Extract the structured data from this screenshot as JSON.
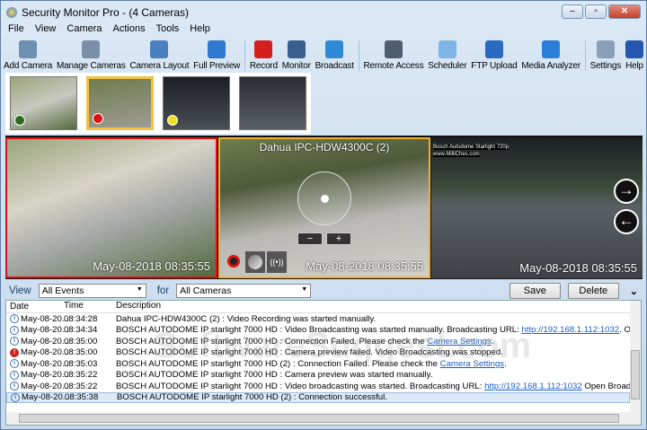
{
  "window": {
    "title": "Security Monitor Pro - (4 Cameras)",
    "min": "–",
    "max": "▫",
    "close": "✕"
  },
  "menu": [
    "File",
    "View",
    "Camera",
    "Actions",
    "Tools",
    "Help"
  ],
  "toolbar": [
    {
      "label": "Add Camera",
      "color": "#6d8fb0"
    },
    {
      "label": "Manage Cameras",
      "color": "#7a90a8"
    },
    {
      "label": "Camera Layout",
      "color": "#4a7fc0"
    },
    {
      "label": "Full Preview",
      "color": "#2f79d0"
    },
    {
      "label": "Record",
      "color": "#d41f1f"
    },
    {
      "label": "Monitor",
      "color": "#3a5f8f"
    },
    {
      "label": "Broadcast",
      "color": "#2e8ad6"
    },
    {
      "label": "Remote Access",
      "color": "#4e5e70"
    },
    {
      "label": "Scheduler",
      "color": "#7fb5e5"
    },
    {
      "label": "FTP Upload",
      "color": "#2a6ac2"
    },
    {
      "label": "Media Analyzer",
      "color": "#2c7fd8"
    },
    {
      "label": "Settings",
      "color": "#8aa0b8"
    },
    {
      "label": "Help",
      "color": "#2458b0"
    }
  ],
  "thumbnails": [
    {
      "dot": "#2d6a1e"
    },
    {
      "dot": "#e01010"
    },
    {
      "dot": "#f0e020"
    },
    {
      "dot": null
    }
  ],
  "cameras": [
    {
      "title": "",
      "timestamp": "May-08-2018 08:35:55"
    },
    {
      "title": "Dahua IPC-HDW4300C (2)",
      "timestamp": "May-08-2018 08:35:55",
      "zoom_out": "−",
      "zoom_in": "+"
    },
    {
      "title": "Bosch Autodome Starlight 720p",
      "subtitle": "www.MilliChes.com",
      "timestamp": "May-08-2018 08:35:55"
    }
  ],
  "events": {
    "view_label": "View",
    "view_value": "All Events",
    "for_label": "for",
    "for_value": "All Cameras",
    "save": "Save",
    "delete": "Delete",
    "columns": [
      "Date",
      "Time",
      "Description"
    ],
    "rows": [
      {
        "type": "info",
        "date": "May-08-20...",
        "time": "08:34:28",
        "desc": "Dahua IPC-HDW4300C (2) : Video Recording was started manually.",
        "link": "",
        "after": ""
      },
      {
        "type": "info",
        "date": "May-08-20...",
        "time": "08:34:34",
        "desc": "BOSCH AUTODOME IP starlight 7000 HD : Video Broadcasting was started manually.  Broadcasting URL: ",
        "link": "http://192.168.1.112:1032",
        "after": ". Open Broadcasting URL in Media"
      },
      {
        "type": "info",
        "date": "May-08-20...",
        "time": "08:35:00",
        "desc": "BOSCH AUTODOME IP starlight 7000 HD : Connection Failed. Please check the ",
        "link": "Camera Settings",
        "after": "."
      },
      {
        "type": "error",
        "date": "May-08-20...",
        "time": "08:35:00",
        "desc": "BOSCH AUTODOME IP starlight 7000 HD : Camera preview failed. Video Broadcasting was stopped.",
        "link": "",
        "after": ""
      },
      {
        "type": "info",
        "date": "May-08-20...",
        "time": "08:35:03",
        "desc": "BOSCH AUTODOME IP starlight 7000 HD (2) :  Connection Failed.  Please check the ",
        "link": "Camera Settings",
        "after": "."
      },
      {
        "type": "info",
        "date": "May-08-20...",
        "time": "08:35:22",
        "desc": "BOSCH AUTODOME IP starlight 7000 HD : Camera preview was started manually.",
        "link": "",
        "after": ""
      },
      {
        "type": "info",
        "date": "May-08-20...",
        "time": "08:35:22",
        "desc": "BOSCH AUTODOME IP starlight 7000 HD : Video broadcasting was started.  Broadcasting URL:  ",
        "link": "http://192.168.1.112:1032",
        "after": " Open Broadcasting URL in Media player."
      },
      {
        "type": "info",
        "date": "May-08-20...",
        "time": "08:35:38",
        "desc": "BOSCH AUTODOME IP starlight 7000 HD (2) : Connection successful.",
        "link": "",
        "after": "",
        "selected": true
      }
    ]
  }
}
